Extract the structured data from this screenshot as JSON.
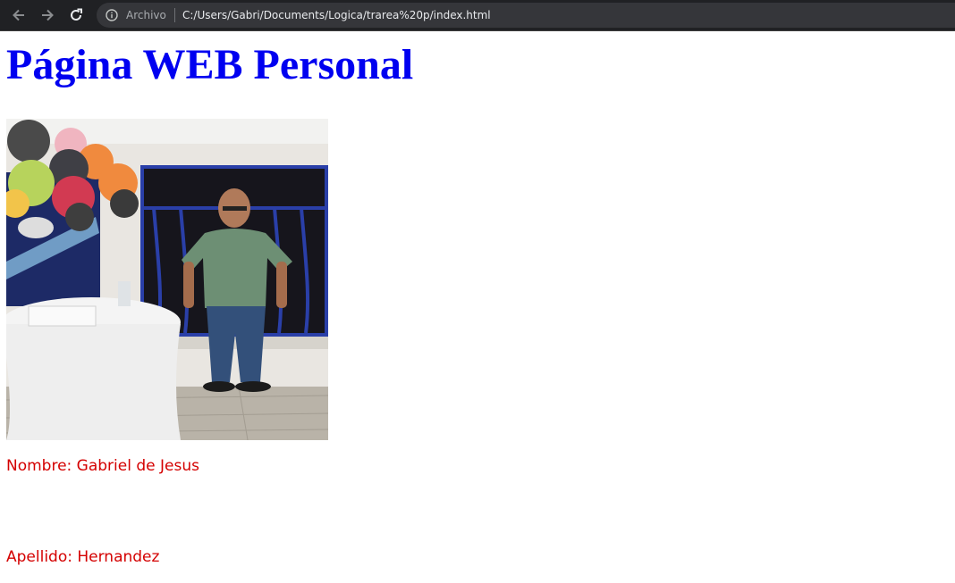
{
  "browser": {
    "back_icon": "arrow-left-icon",
    "forward_icon": "arrow-right-icon",
    "reload_icon": "reload-icon",
    "site_info_icon": "info-icon",
    "scheme_label": "Archivo",
    "url": "C:/Users/Gabri/Documents/Logica/trarea%20p/index.html"
  },
  "page": {
    "title": "Página WEB Personal",
    "nombre": "Nombre: Gabriel de Jesus",
    "apellido": "Apellido: Hernandez"
  },
  "colors": {
    "title": "#0000f0",
    "fields": "#d40000",
    "toolbar": "#202124"
  }
}
